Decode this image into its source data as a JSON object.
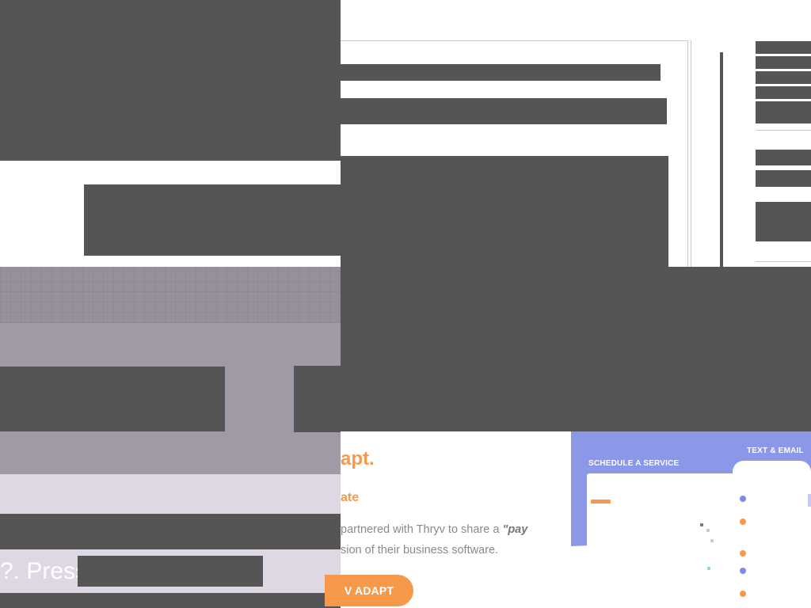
{
  "promo": {
    "logo_text": "apt.",
    "subheading": "ate",
    "body_line1": "partnered with Thryv to share a ",
    "body_emphasis": "\"pay",
    "body_line2": "sion of their business software.",
    "cta_label": "V ADAPT"
  },
  "hero": {
    "press_text": "?. Press"
  },
  "mockup": {
    "label_schedule": "SCHEDULE A SERVICE",
    "label_text_email": "TEXT & EMAIL"
  },
  "colors": {
    "accent_orange": "#f7994b",
    "mock_blue": "#8b98e8",
    "redaction": "#555555",
    "hero_purple": "#a19aa6"
  }
}
